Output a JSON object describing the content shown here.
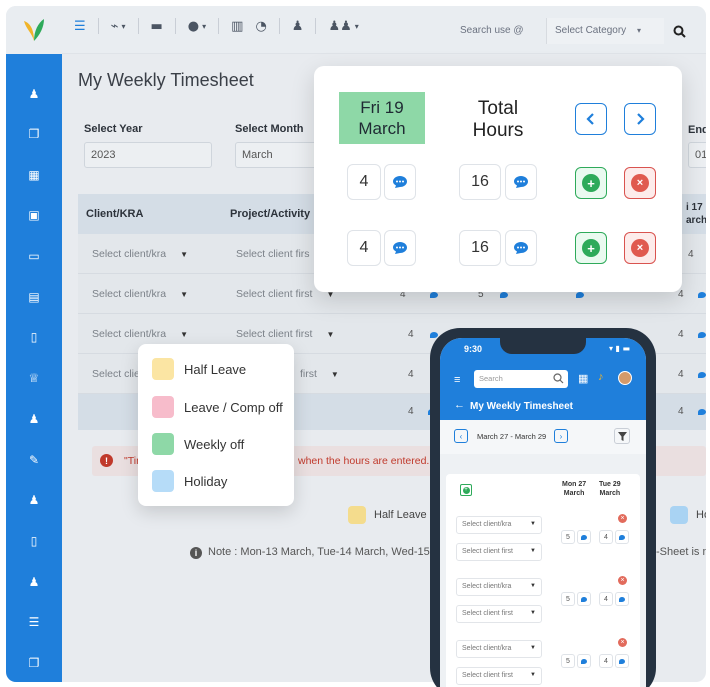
{
  "topbar": {
    "search_placeholder": "Search use",
    "category_label": "Select Category"
  },
  "page": {
    "title": "My Weekly Timesheet",
    "select_year_label": "Select Year",
    "select_year_value": "2023",
    "select_month_label": "Select Month",
    "select_month_value": "March",
    "end_label": "End",
    "end_value": "01-"
  },
  "table": {
    "col_client": "Client/KRA",
    "col_project": "Project/Activity",
    "col_right_day": "i 17",
    "col_right_month": "arch",
    "rows": [
      {
        "client": "Select client/kra",
        "project": "Select client firs",
        "vals": [
          "4",
          "4",
          "4"
        ]
      },
      {
        "client": "Select client/kra",
        "project": "Select client first",
        "vals": [
          "4",
          "5",
          "4"
        ]
      },
      {
        "client": "Select client/kra",
        "project": "Select client first",
        "vals": [
          "4",
          "4",
          "4"
        ]
      },
      {
        "client": "Select clie",
        "project": "first",
        "vals": [
          "4",
          "4",
          "4"
        ]
      }
    ],
    "total_val": "4",
    "total_right": "4"
  },
  "warning": {
    "prefix": "\"Tin",
    "text": "when the hours are entered."
  },
  "legend_bar": {
    "half_leave": "Half Leave",
    "right": "Ho"
  },
  "note": {
    "text": "Note : Mon-13 March, Tue-14 March, Wed-15",
    "right": "-Sheet is no"
  },
  "legend_card": {
    "items": [
      {
        "label": "Half Leave",
        "color": "#fbe5a3"
      },
      {
        "label": "Leave / Comp off",
        "color": "#f7bccb"
      },
      {
        "label": "Weekly off",
        "color": "#8ed8a7"
      },
      {
        "label": "Holiday",
        "color": "#b6dcf8"
      }
    ]
  },
  "overlay": {
    "day_line1": "Fri 19",
    "day_line2": "March",
    "total_line1": "Total",
    "total_line2": "Hours",
    "rows": [
      {
        "hours": "4",
        "total": "16"
      },
      {
        "hours": "4",
        "total": "16"
      }
    ]
  },
  "phone": {
    "time": "9:30",
    "search_placeholder": "Search",
    "title": "My Weekly Timesheet",
    "date_range": "March 27 - March 29",
    "col1_day": "Mon 27",
    "col1_month": "March",
    "col2_day": "Tue 29",
    "col2_month": "March",
    "entries": [
      {
        "client": "Select client/kra",
        "project": "Select client first",
        "v1": "5",
        "v2": "4"
      },
      {
        "client": "Select client/kra",
        "project": "Select client first",
        "v1": "5",
        "v2": "4"
      },
      {
        "client": "Select client/kra",
        "project": "Select client first",
        "v1": "5",
        "v2": "4"
      }
    ]
  },
  "colors": {
    "brand_blue": "#1f7fdb",
    "weekly_off_green": "#8ed8a7",
    "add_green": "#2eaa5a",
    "delete_red": "#d9534f"
  }
}
